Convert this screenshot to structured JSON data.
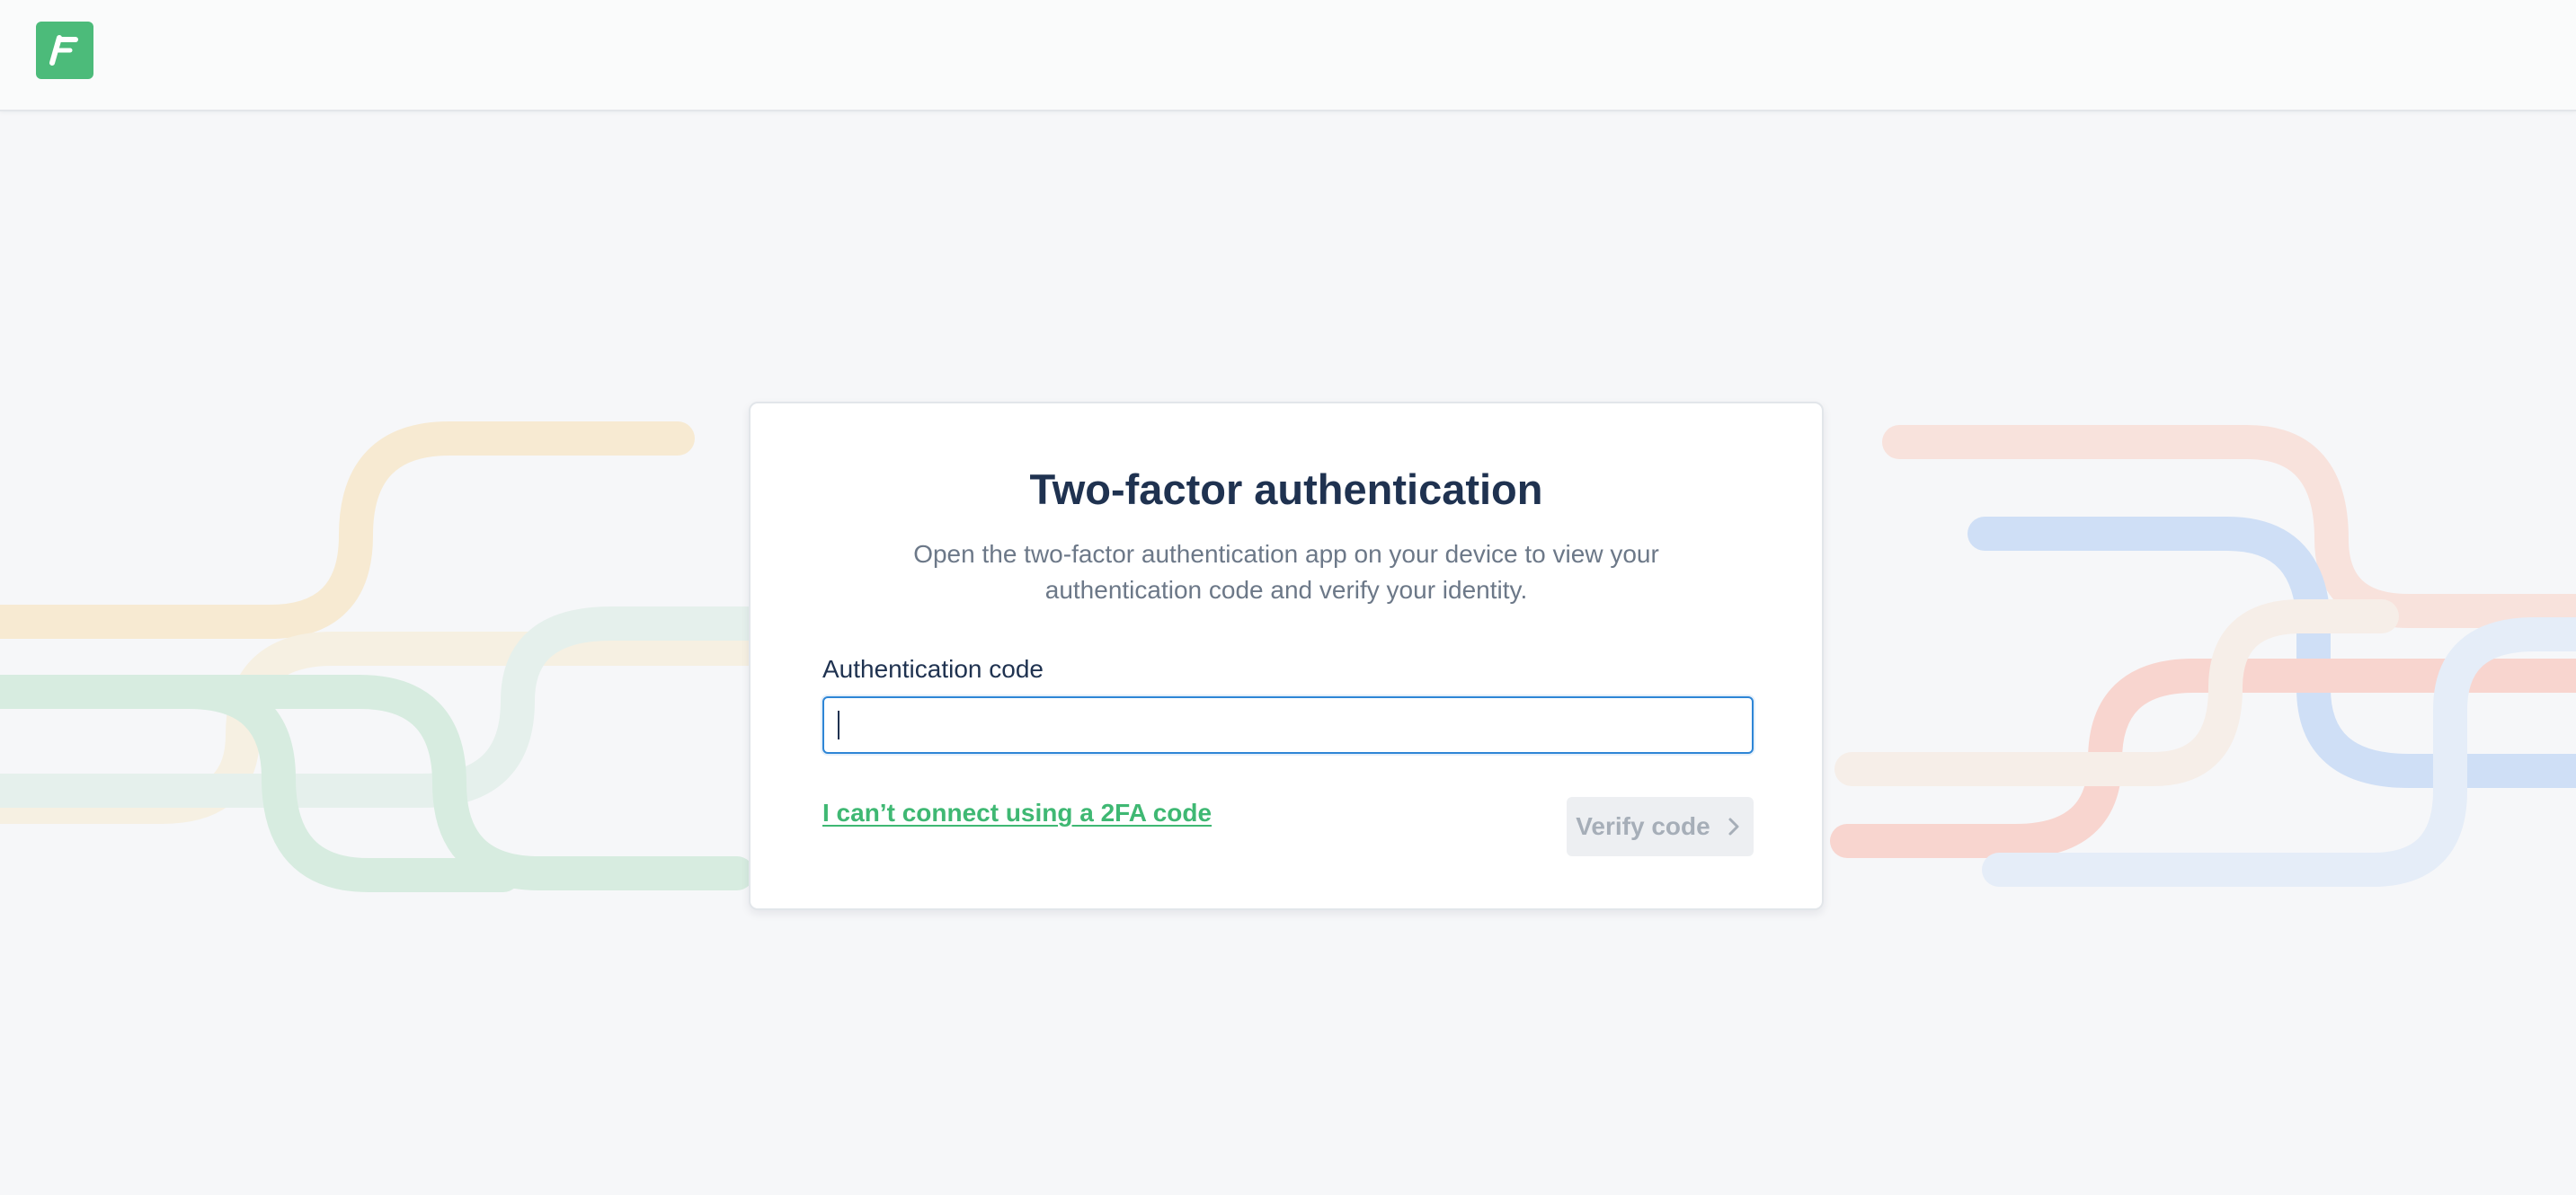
{
  "header": {
    "logo_icon": "brand-logo-f-icon",
    "logo_color": "#4cbb7a"
  },
  "card": {
    "title": "Two-factor authentication",
    "subtitle": "Open the two-factor authentication app on your device to view your authentication code and verify your identity.",
    "field_label": "Authentication code",
    "field_value": "",
    "field_placeholder": "",
    "help_link": "I can’t connect using a 2FA code",
    "verify_button": "Verify code",
    "verify_icon": "chevron-right-icon"
  },
  "colors": {
    "accent_green": "#3fb873",
    "focus_blue": "#2e86d6",
    "title_navy": "#1f3250",
    "background": "#f6f7f9"
  }
}
